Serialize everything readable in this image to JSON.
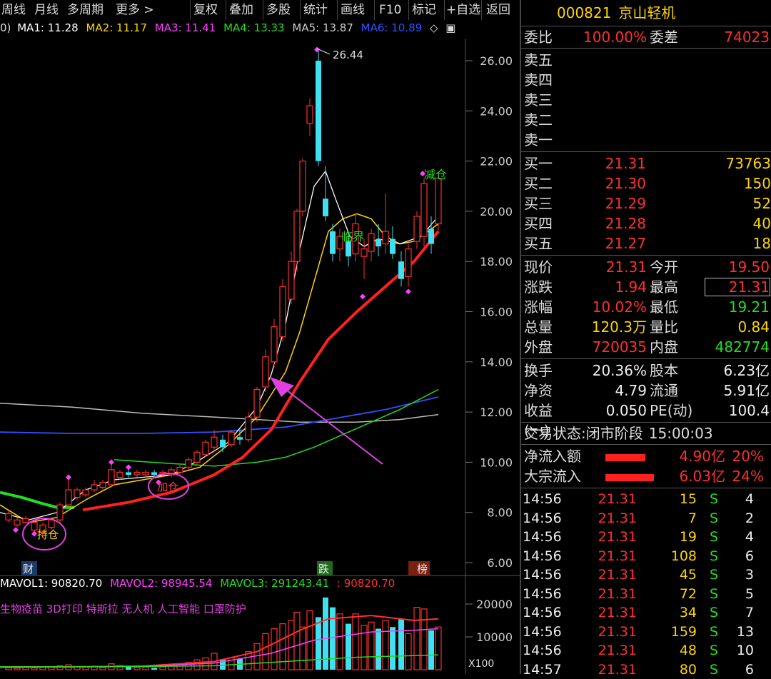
{
  "toolbar": {
    "items": [
      "周线",
      "月线",
      "多周期",
      "更多 >",
      "复权",
      "叠加",
      "多股",
      "统计",
      "画线",
      "F10",
      "标记",
      "+自选",
      "返回"
    ]
  },
  "ma": {
    "prefix": "0)",
    "items": [
      {
        "label": "MA1: 11.28",
        "color": "#ffffff"
      },
      {
        "label": "MA2: 11.17",
        "color": "#ffd400"
      },
      {
        "label": "MA3: 11.41",
        "color": "#ff40ff"
      },
      {
        "label": "MA4: 13.33",
        "color": "#22dd22"
      },
      {
        "label": "MA5: 13.87",
        "color": "#cccccc"
      },
      {
        "label": "MA6: 10.89",
        "color": "#3050ff"
      }
    ]
  },
  "chart_data": {
    "type": "candlestick",
    "ylim": [
      6.0,
      26.44
    ],
    "price_ticks": [
      "26.00",
      "24.00",
      "22.00",
      "20.00",
      "18.00",
      "16.00",
      "14.00",
      "12.00",
      "10.00",
      "8.00",
      "6.00"
    ],
    "price_tick_values": [
      26,
      24,
      22,
      20,
      18,
      16,
      14,
      12,
      10,
      8,
      6
    ],
    "high_label": "26.44",
    "annotations": [
      "临界",
      "减仓",
      "加仓",
      "持仓"
    ],
    "markers": [
      "财",
      "跌",
      "榜"
    ],
    "volume": {
      "ticks": [
        "20000",
        "10000"
      ],
      "tick_values": [
        20000,
        10000
      ],
      "unit": "X100"
    }
  },
  "volume_header": {
    "items": [
      {
        "label": "MAVOL1: 90820.70",
        "color": "#ffffff"
      },
      {
        "label": "MAVOL2: 98945.54",
        "color": "#ff40ff"
      },
      {
        "label": "MAVOL3: 291243.41",
        "color": "#22dd22"
      },
      {
        "label": ": 90820.70",
        "color": "#ff3030"
      }
    ]
  },
  "concepts": "生物疫苗 3D打印 特斯拉 无人机 人工智能 口罩防护",
  "stock": {
    "code": "000821",
    "name": "京山轻机"
  },
  "weibi": {
    "label": "委比",
    "value": "100.00%",
    "label2": "委差",
    "value2": "74023"
  },
  "sell": [
    {
      "label": "卖五"
    },
    {
      "label": "卖四"
    },
    {
      "label": "卖三"
    },
    {
      "label": "卖二"
    },
    {
      "label": "卖一"
    }
  ],
  "buy": [
    {
      "label": "买一",
      "price": "21.31",
      "qty": "73763"
    },
    {
      "label": "买二",
      "price": "21.30",
      "qty": "150"
    },
    {
      "label": "买三",
      "price": "21.29",
      "qty": "52"
    },
    {
      "label": "买四",
      "price": "21.28",
      "qty": "40"
    },
    {
      "label": "买五",
      "price": "21.27",
      "qty": "18"
    }
  ],
  "quote": [
    {
      "l1": "现价",
      "v1": "21.31",
      "c1": "red",
      "l2": "今开",
      "v2": "19.50",
      "c2": "red"
    },
    {
      "l1": "涨跌",
      "v1": "1.94",
      "c1": "red",
      "l2": "最高",
      "v2": "21.31",
      "c2": "red"
    },
    {
      "l1": "涨幅",
      "v1": "10.02%",
      "c1": "red",
      "l2": "最低",
      "v2": "19.21",
      "c2": "green"
    },
    {
      "l1": "总量",
      "v1": "120.3万",
      "c1": "yellow",
      "l2": "量比",
      "v2": "0.84",
      "c2": "yellow"
    },
    {
      "l1": "外盘",
      "v1": "720035",
      "c1": "red",
      "l2": "内盘",
      "v2": "482774",
      "c2": "green"
    }
  ],
  "fund": [
    {
      "l1": "换手",
      "v1": "20.36%",
      "l2": "股本",
      "v2": "6.23亿"
    },
    {
      "l1": "净资",
      "v1": "4.79",
      "l2": "流通",
      "v2": "5.91亿"
    },
    {
      "l1": "收益(一)",
      "v1": "0.050",
      "l2": "PE(动)",
      "v2": "100.4"
    }
  ],
  "status": {
    "label": "交易状态:",
    "value": "闭市阶段",
    "time": "15:00:03"
  },
  "flows": [
    {
      "label": "净流入额",
      "value": "4.90亿",
      "pct": "20%",
      "fill": 0.2
    },
    {
      "label": "大宗流入",
      "value": "6.03亿",
      "pct": "24%",
      "fill": 0.24
    }
  ],
  "ticks": [
    {
      "time": "14:56",
      "price": "21.31",
      "vol": "15",
      "side": "S",
      "n": "4"
    },
    {
      "time": "14:56",
      "price": "21.31",
      "vol": "7",
      "side": "S",
      "n": "2"
    },
    {
      "time": "14:56",
      "price": "21.31",
      "vol": "19",
      "side": "S",
      "n": "4"
    },
    {
      "time": "14:56",
      "price": "21.31",
      "vol": "108",
      "side": "S",
      "n": "6"
    },
    {
      "time": "14:56",
      "price": "21.31",
      "vol": "45",
      "side": "S",
      "n": "3"
    },
    {
      "time": "14:56",
      "price": "21.31",
      "vol": "72",
      "side": "S",
      "n": "5"
    },
    {
      "time": "14:56",
      "price": "21.31",
      "vol": "34",
      "side": "S",
      "n": "7"
    },
    {
      "time": "14:56",
      "price": "21.31",
      "vol": "159",
      "side": "S",
      "n": "13"
    },
    {
      "time": "14:56",
      "price": "21.31",
      "vol": "48",
      "side": "S",
      "n": "10"
    },
    {
      "time": "14:57",
      "price": "21.31",
      "vol": "80",
      "side": "S",
      "n": "6"
    }
  ]
}
